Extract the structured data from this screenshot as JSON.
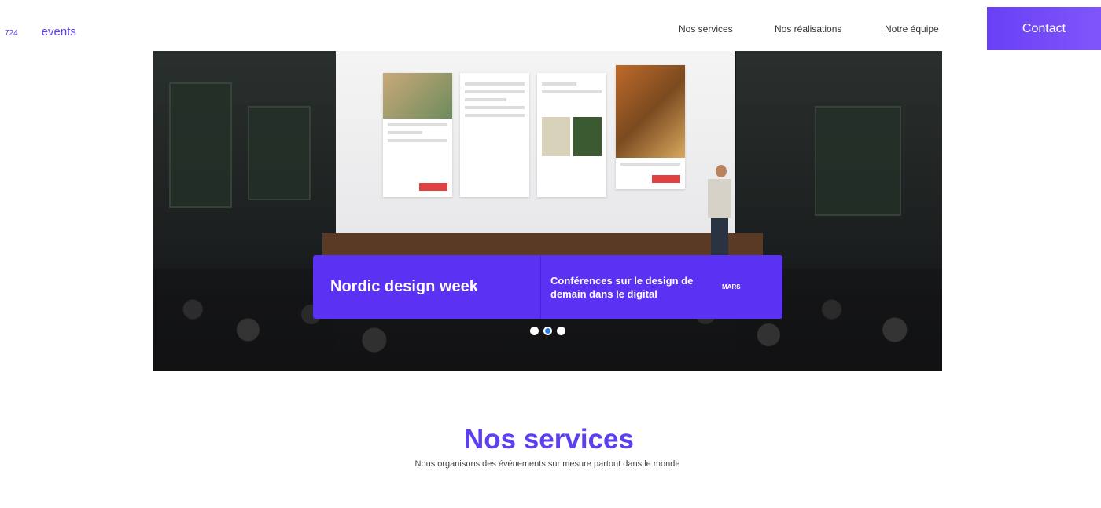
{
  "brand": {
    "number": "724",
    "name": "events"
  },
  "nav": {
    "items": [
      "Nos services",
      "Nos réalisations",
      "Notre équipe"
    ]
  },
  "contact": {
    "label": "Contact"
  },
  "hero": {
    "caption_title": "Nordic design week",
    "caption_desc": "Conférences sur le design de demain dans le digital",
    "caption_month": "MARS",
    "slides_total": 3,
    "active_slide": 2
  },
  "services": {
    "title": "Nos services",
    "subtitle": "Nous organisons des événements sur mesure partout dans le monde"
  },
  "colors": {
    "accent": "#5b31f4",
    "brand": "#5b3ff0"
  }
}
